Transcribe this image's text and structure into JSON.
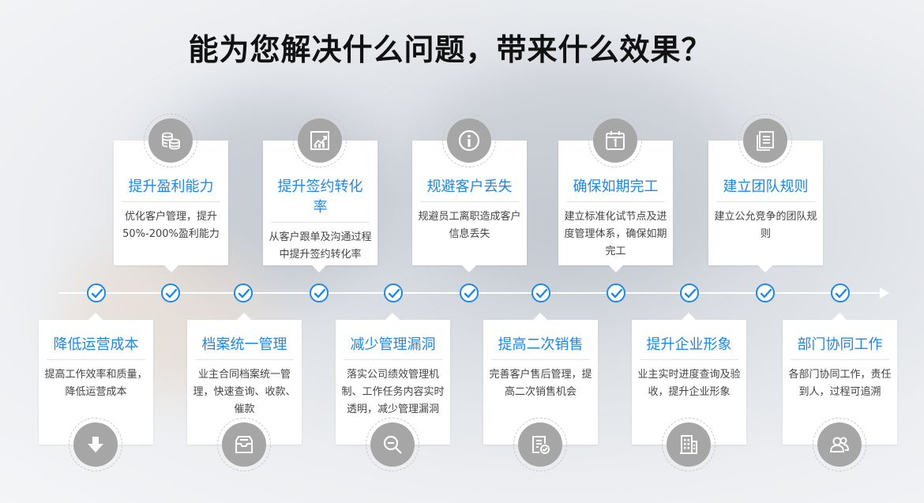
{
  "page": {
    "title": "能为您解决什么问题，带来什么效果？"
  },
  "colors": {
    "accent": "#1e88e5",
    "icon_bg": "#a6a6a6"
  },
  "top_cards": [
    {
      "title": "提升盈利能力",
      "desc": "优化客户管理，提升50%-200%盈利能力",
      "icon": "coins-icon"
    },
    {
      "title": "提升签约转化率",
      "desc": "从客户跟单及沟通过程中提升签约转化率",
      "icon": "chart-up-icon"
    },
    {
      "title": "规避客户丢失",
      "desc": "规避员工离职造成客户信息丢失",
      "icon": "info-icon"
    },
    {
      "title": "确保如期完工",
      "desc": "建立标准化试节点及进度管理体系，确保如期完工",
      "icon": "calendar-icon"
    },
    {
      "title": "建立团队规则",
      "desc": "建立公允竞争的团队规则",
      "icon": "documents-icon"
    }
  ],
  "bottom_cards": [
    {
      "title": "降低运营成本",
      "desc": "提高工作效率和质量，降低运营成本",
      "icon": "arrow-down-icon"
    },
    {
      "title": "档案统一管理",
      "desc": "业主合同档案统一管理，快速查询、收款、催款",
      "icon": "inbox-icon"
    },
    {
      "title": "减少管理漏洞",
      "desc": "落实公司绩效管理机制、工作任务内容实时透明，减少管理漏洞",
      "icon": "search-minus-icon"
    },
    {
      "title": "提高二次销售",
      "desc": "完善客户售后管理，提高二次销售机会",
      "icon": "document-check-icon"
    },
    {
      "title": "提升企业形象",
      "desc": "业主实时进度查询及验收，提升企业形象",
      "icon": "building-icon"
    },
    {
      "title": "部门协同工作",
      "desc": "各部门协同工作，责任到人，过程可追溯",
      "icon": "users-icon"
    }
  ]
}
